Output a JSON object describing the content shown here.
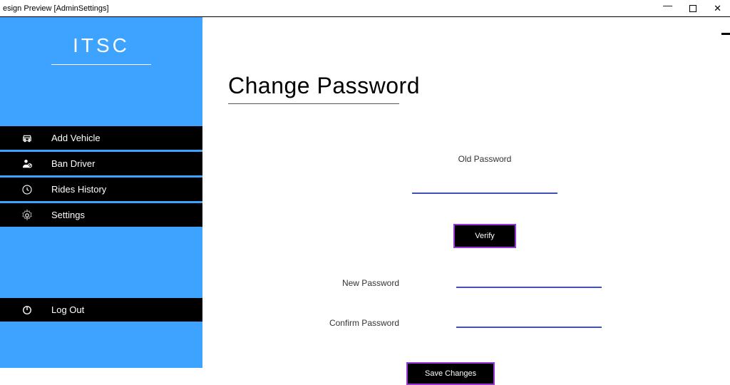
{
  "window": {
    "title": "esign Preview [AdminSettings]"
  },
  "sidebar": {
    "brand": "ITSC",
    "items": [
      {
        "label": "Add Vehicle",
        "icon": "car"
      },
      {
        "label": "Ban Driver",
        "icon": "user-ban"
      },
      {
        "label": "Rides History",
        "icon": "clock"
      },
      {
        "label": "Settings",
        "icon": "gear"
      }
    ],
    "logout": {
      "label": "Log Out",
      "icon": "power"
    }
  },
  "page": {
    "title": "Change Password",
    "oldPasswordLabel": "Old Password",
    "verifyLabel": "Verify",
    "newPasswordLabel": "New Password",
    "confirmPasswordLabel": "Confirm Password",
    "saveLabel": "Save Changes"
  },
  "colors": {
    "sidebar": "#3ea3ff",
    "buttonBorder": "#9a37d6",
    "inputLine": "#3f51b5"
  }
}
